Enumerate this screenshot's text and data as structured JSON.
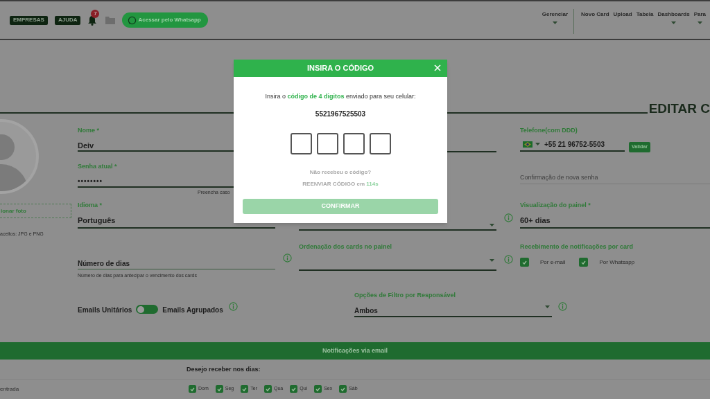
{
  "topbar": {
    "buttons": [
      "EMPRESAS",
      "AJUDA"
    ],
    "notification_count": "7",
    "whatsapp_button": "Acessar pelo Whatsapp",
    "nav": [
      {
        "label": "Gerenciar",
        "dropdown": true
      },
      {
        "label": "Novo Card",
        "dropdown": false
      },
      {
        "label": "Upload",
        "dropdown": false
      },
      {
        "label": "Tabela",
        "dropdown": false
      },
      {
        "label": "Dashboards",
        "dropdown": true
      },
      {
        "label": "Para",
        "dropdown": true
      }
    ]
  },
  "page_title": "EDITAR C",
  "profile_photo": {
    "button": "ionar foto",
    "hint": "aceitos: JPG e PNG"
  },
  "name": {
    "label": "Nome *",
    "value": "Deiv"
  },
  "phone": {
    "label": "Telefone(com DDD)",
    "value": "+55 21 96752-5503",
    "button": "Validar"
  },
  "current_password": {
    "label": "Senha atual *",
    "value": "••••••••",
    "hint": "Preencha caso"
  },
  "confirm_password": {
    "placeholder": "Confirmação de nova senha"
  },
  "language": {
    "label": "Idioma *",
    "value": "Português"
  },
  "panel_view": {
    "label": "Visualização do painel *",
    "value": "60+ dias"
  },
  "days_ahead": {
    "placeholder": "Número de dias",
    "hint": "Número de dias para antecipar o vencimento dos cards"
  },
  "card_order": {
    "label": "Ordenação dos cards no painel"
  },
  "card_notifications": {
    "label": "Recebimento de notificações por card",
    "options": [
      {
        "label": "Por e-mail",
        "checked": true
      },
      {
        "label": "Por Whatsapp",
        "checked": true
      }
    ]
  },
  "email_mode": {
    "left": "Emails Unitários",
    "right": "Emails Agrupados",
    "on": false
  },
  "responsible_filter": {
    "label": "Opções de Filtro por Responsável",
    "value": "Ambos"
  },
  "email_notifications": {
    "title": "Notificações via email",
    "days_label": "Desejo receber nos dias:",
    "row_label": "entrada",
    "days": [
      {
        "label": "Dom",
        "checked": true
      },
      {
        "label": "Seg",
        "checked": true
      },
      {
        "label": "Ter",
        "checked": true
      },
      {
        "label": "Qua",
        "checked": true
      },
      {
        "label": "Qui",
        "checked": true
      },
      {
        "label": "Sex",
        "checked": true
      },
      {
        "label": "Sáb",
        "checked": true
      }
    ]
  },
  "modal": {
    "title": "INSIRA O CÓDIGO",
    "message": {
      "before": "Insira o",
      "highlight": "código de 4 digitos",
      "after": "enviado para seu celular:"
    },
    "phone": "5521967525503",
    "code_boxes": [
      {
        "filled": false
      },
      {
        "filled": false
      },
      {
        "filled": false
      },
      {
        "filled": false
      }
    ],
    "resend_question": "Não recebeu o código?",
    "resend": {
      "label": "REENVIAR CÓDIGO",
      "middle": "em",
      "countdown": "114s"
    },
    "confirm_button": {
      "label": "CONFIRMAR",
      "disabled": true
    }
  }
}
